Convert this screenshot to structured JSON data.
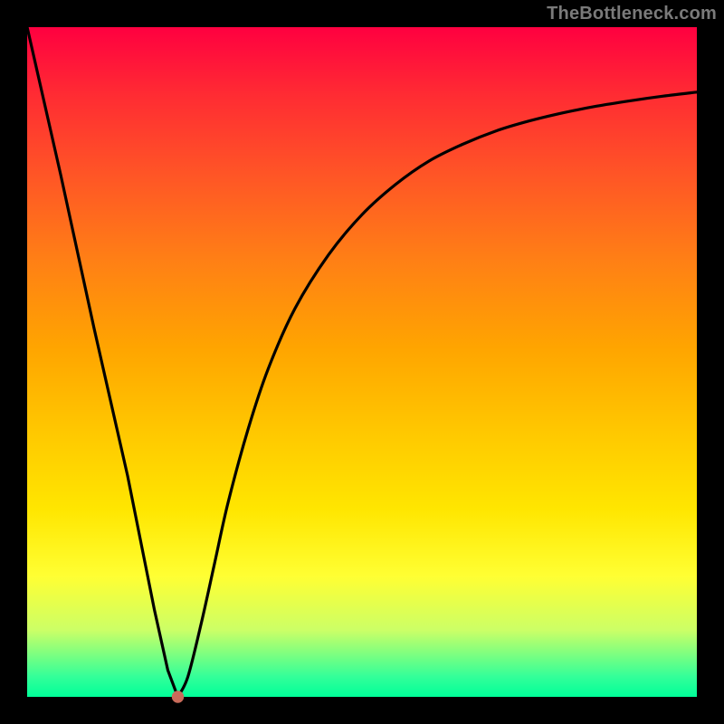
{
  "watermark": "TheBottleneck.com",
  "colors": {
    "frame": "#000000",
    "curve": "#000000",
    "dot": "#c96b5a"
  },
  "chart_data": {
    "type": "line",
    "title": "",
    "xlabel": "",
    "ylabel": "",
    "xlim": [
      0,
      100
    ],
    "ylim": [
      0,
      100
    ],
    "optimum_x": 22.5,
    "grid": false,
    "series": [
      {
        "name": "bottleneck-curve",
        "x": [
          0,
          5,
          10,
          15,
          19,
          21,
          22.5,
          24,
          26,
          28,
          30,
          33,
          36,
          40,
          45,
          50,
          55,
          60,
          65,
          70,
          75,
          80,
          85,
          90,
          95,
          100
        ],
        "values": [
          100,
          78,
          55,
          33,
          13,
          4,
          0,
          3,
          11,
          20,
          29,
          40,
          49,
          58,
          66,
          72,
          76.5,
          80,
          82.5,
          84.5,
          86,
          87.2,
          88.2,
          89,
          89.7,
          90.3
        ]
      }
    ],
    "annotations": [
      {
        "type": "dot",
        "x": 22.5,
        "y": 0,
        "label": "optimum"
      }
    ],
    "background_gradient": {
      "direction": "vertical",
      "stops": [
        {
          "pos": 0,
          "color": "#ff0040"
        },
        {
          "pos": 0.5,
          "color": "#ffa500"
        },
        {
          "pos": 0.82,
          "color": "#ffff33"
        },
        {
          "pos": 1.0,
          "color": "#00ff99"
        }
      ]
    }
  }
}
